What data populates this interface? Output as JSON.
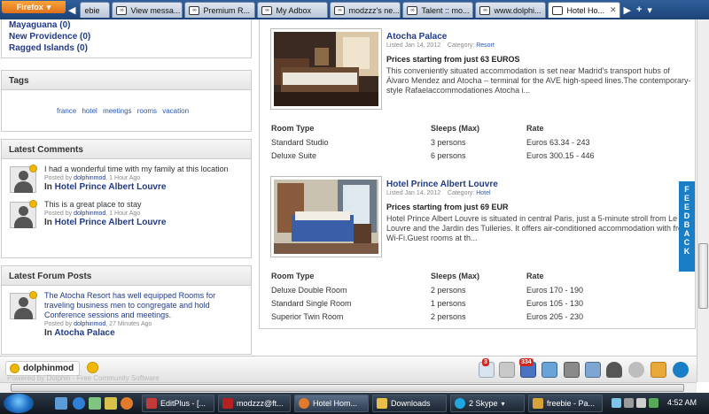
{
  "browser": {
    "menu_label": "Firefox",
    "tabs": [
      {
        "label": "ebie",
        "favicon": "blank-page-icon"
      },
      {
        "label": "View messa...",
        "favicon": "site-icon"
      },
      {
        "label": "Premium R...",
        "favicon": "site-icon"
      },
      {
        "label": "My Adbox",
        "favicon": "site-icon"
      },
      {
        "label": "modzzz's ne...",
        "favicon": "site-icon"
      },
      {
        "label": "Talent :: mo...",
        "favicon": "site-icon"
      },
      {
        "label": "www.dolphi...",
        "favicon": "site-icon"
      },
      {
        "label": "Hotel Ho...",
        "favicon": "blank-page-icon"
      }
    ],
    "new_tab_label": "+"
  },
  "sidebar": {
    "locations": [
      {
        "label": "Mayaguana (0)"
      },
      {
        "label": "New Providence (0)"
      },
      {
        "label": "Ragged Islands (0)"
      }
    ],
    "tags": {
      "title": "Tags",
      "items": [
        "france",
        "hotel",
        "meetings",
        "rooms",
        "vacation"
      ]
    },
    "latest_comments": {
      "title": "Latest Comments",
      "items": [
        {
          "text": "I had a wonderful time with my family at this location",
          "posted_by": "Posted by",
          "author": "dolphinmod",
          "ago": ", 1 Hour Ago",
          "in_prefix": "In",
          "target": "Hotel Prince Albert Louvre"
        },
        {
          "text": "This is a great place to stay",
          "posted_by": "Posted by",
          "author": "dolphinmod",
          "ago": ", 1 Hour Ago",
          "in_prefix": "In",
          "target": "Hotel Prince Albert Louvre"
        }
      ]
    },
    "latest_forum": {
      "title": "Latest Forum Posts",
      "items": [
        {
          "text": "The Atocha Resort has well equipped Rooms for traveling business men to congregate and hold Conference sessions and meetings.",
          "posted_by": "Posted by",
          "author": "dolphinmod",
          "ago": ", 27 Minutes Ago",
          "in_prefix": "In",
          "target": "Atocha Palace"
        }
      ]
    }
  },
  "listings": [
    {
      "title": "Atocha Palace",
      "listed": "Listed Jan 14, 2012",
      "category_label": "Category:",
      "category": "Resort",
      "price": "Prices starting from just 63 EUROS",
      "description": "This conveniently situated accommodation is set near Madrid's transport hubs of Álvaro Mendez and Atocha – terminal for the AVE high-speed lines.The contemporary-style Rafaelaccommodationes Atocha i...",
      "columns": [
        "Room Type",
        "Sleeps (Max)",
        "Rate"
      ],
      "rooms": [
        {
          "type": "Standard Studio",
          "sleeps": "3 persons",
          "rate": "Euros 63.34 - 243"
        },
        {
          "type": "Deluxe Suite",
          "sleeps": "6 persons",
          "rate": "Euros 300.15 - 446"
        }
      ]
    },
    {
      "title": "Hotel Prince Albert Louvre",
      "listed": "Listed Jan 14, 2012",
      "category_label": "Category:",
      "category": "Hotel",
      "price": "Prices starting from just 69 EUR",
      "description": "Hotel Prince Albert Louvre is situated in central Paris, just a 5-minute stroll from Le Louvre and the Jardin des Tuileries. It offers air-conditioned accommodation with free Wi-Fi.Guest rooms at th...",
      "columns": [
        "Room Type",
        "Sleeps (Max)",
        "Rate"
      ],
      "rooms": [
        {
          "type": "Deluxe Double Room",
          "sleeps": "2 persons",
          "rate": "Euros 170 - 190"
        },
        {
          "type": "Standard Single Room",
          "sleeps": "1 persons",
          "rate": "Euros 105 - 130"
        },
        {
          "type": "Superior Twin Room",
          "sleeps": "2 persons",
          "rate": "Euros 205 - 230"
        }
      ]
    }
  ],
  "feedback": {
    "label": "FEEDBACK"
  },
  "dolphin_bar": {
    "username": "dolphinmod",
    "powered_by": "Powered by Dolphin - Free Community Software",
    "icons": [
      {
        "name": "mail-icon",
        "badge": "3"
      },
      {
        "name": "cart-icon",
        "badge": ""
      },
      {
        "name": "notifications-icon",
        "badge": "334"
      },
      {
        "name": "friends-icon",
        "badge": ""
      },
      {
        "name": "members-icon",
        "badge": ""
      },
      {
        "name": "profile-icon",
        "badge": ""
      },
      {
        "name": "chat-icon",
        "badge": ""
      },
      {
        "name": "settings-icon",
        "badge": ""
      },
      {
        "name": "folder-icon",
        "badge": ""
      },
      {
        "name": "power-icon",
        "badge": ""
      }
    ]
  },
  "taskbar": {
    "buttons": [
      {
        "label": "EditPlus - [..."
      },
      {
        "label": "modzzz@ft..."
      },
      {
        "label": "Hotel Hom..."
      },
      {
        "label": "Downloads"
      },
      {
        "label": "2 Skype"
      },
      {
        "label": "freebie - Pa..."
      }
    ],
    "clock": "4:52 AM"
  }
}
